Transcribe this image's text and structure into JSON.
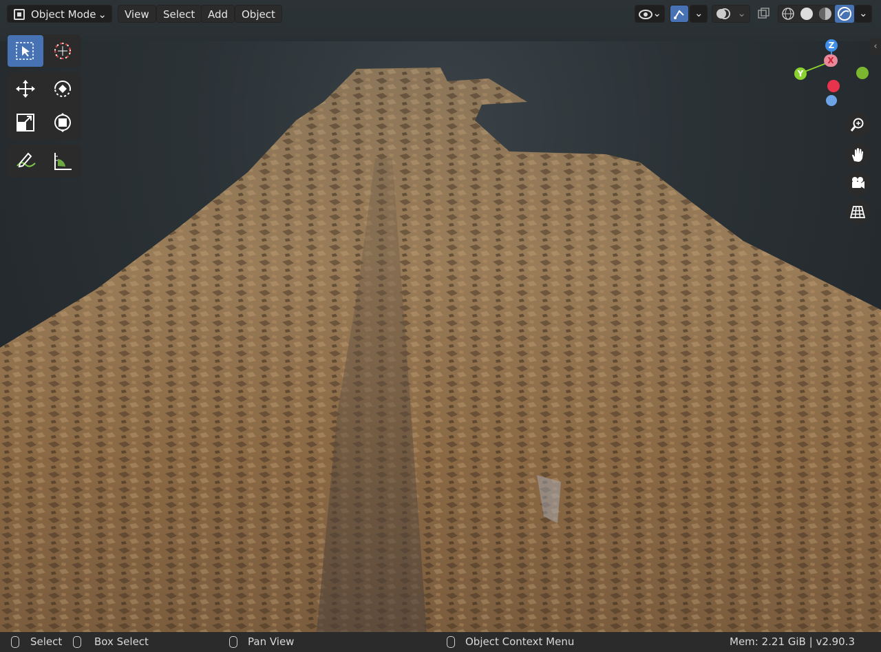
{
  "header": {
    "mode_label": "Object Mode",
    "menu": [
      "View",
      "Select",
      "Add",
      "Object"
    ]
  },
  "toolbar": {
    "tools": [
      "select-box",
      "cursor",
      "move",
      "rotate",
      "scale",
      "transform",
      "annotate",
      "measure"
    ],
    "active_tool": "select-box"
  },
  "navigation": {
    "axes": {
      "z": "Z",
      "y": "Y",
      "x": "X"
    },
    "buttons": [
      "zoom",
      "pan",
      "camera",
      "ortho-grid"
    ]
  },
  "status": {
    "select": "Select",
    "box_select": "Box Select",
    "pan_view": "Pan View",
    "context_menu": "Object Context Menu",
    "mem": "Mem: 2.21 GiB | v2.90.3"
  },
  "colors": {
    "accent": "#4772b3",
    "x_axis": "#e8334d",
    "y_axis": "#8bd12f",
    "z_axis": "#3f8fe8",
    "terrain": "#8a6a45"
  }
}
